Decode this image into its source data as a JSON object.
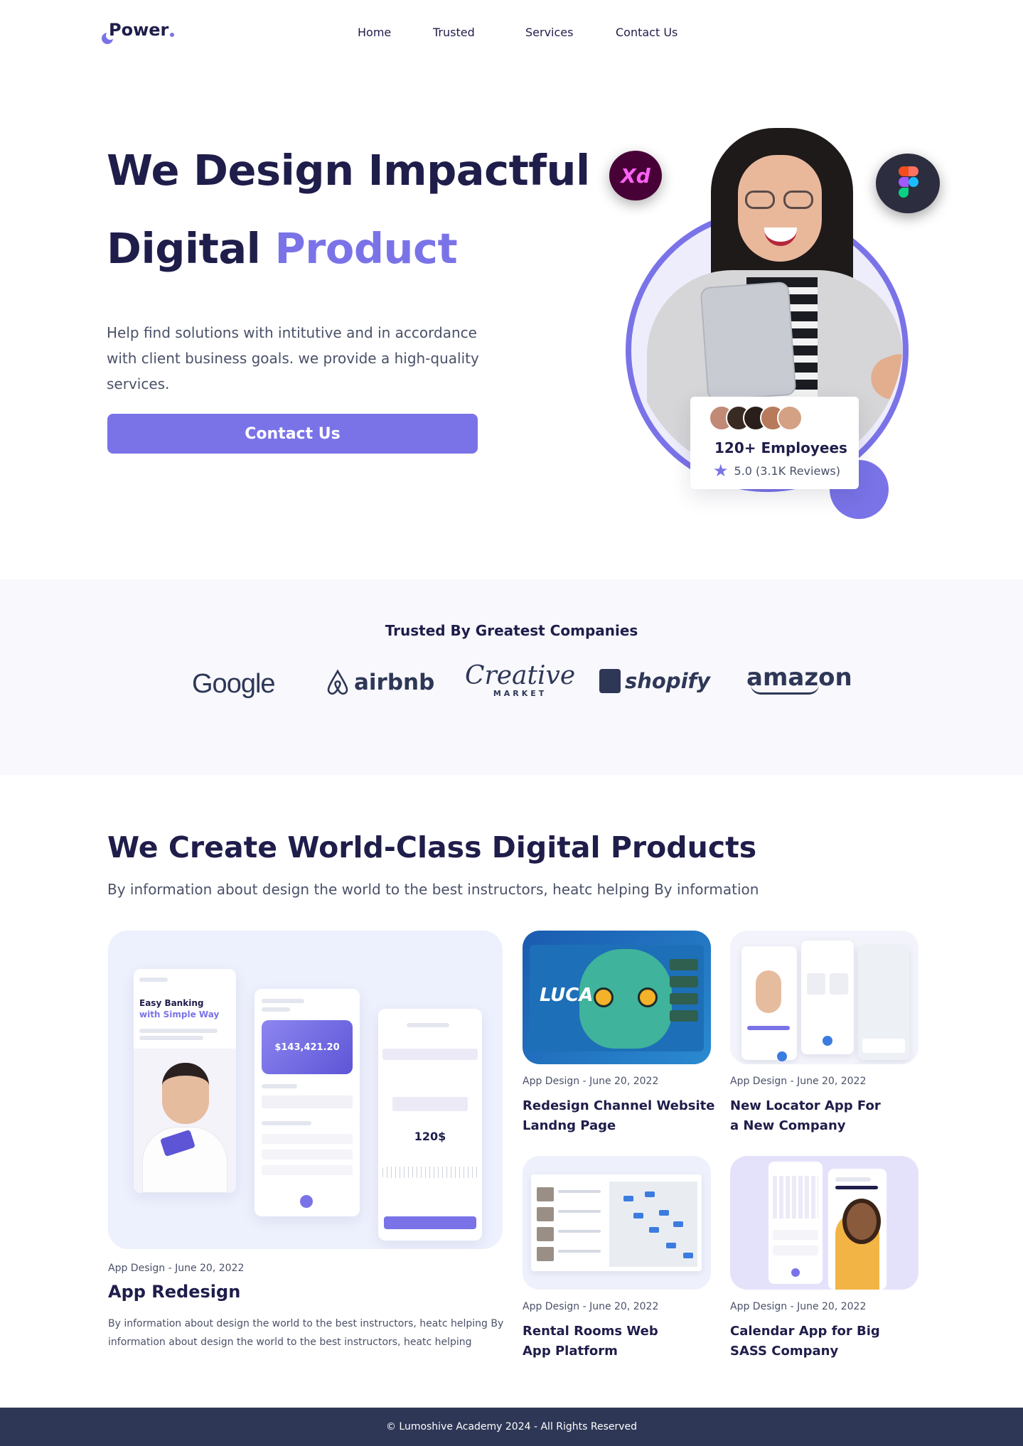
{
  "brand": {
    "name": "Power",
    "accent": "#7a73e8",
    "dark": "#1f1d4a"
  },
  "nav": {
    "items": [
      "Home",
      "Trusted",
      "Services",
      "Contact Us"
    ]
  },
  "hero": {
    "title_line1": "We Design Impactful",
    "title_line2_plain": "Digital",
    "title_line2_accent": "Product",
    "subtitle": "Help find solutions with intitutive and in accordance with client business goals. we provide a high-quality services.",
    "cta": "Contact Us",
    "badges": [
      "adobe-xd-icon",
      "figma-icon"
    ],
    "employees_card": {
      "title": "120+ Employees",
      "rating": "5.0 (3.1K Reviews)",
      "avatars": 5
    }
  },
  "trusted": {
    "title": "Trusted By Greatest Companies",
    "logos": [
      "Google",
      "airbnb",
      "Creative",
      "MARKET",
      "shopify",
      "amazon"
    ]
  },
  "products": {
    "title": "We Create World-Class Digital Products",
    "subtitle": "By information about design the world to the best instructors, heatc helping By information",
    "featured": {
      "meta": "App Design - June 20, 2022",
      "title": "App Redesign",
      "description": "By information about design the world to the best instructors, heatc helping By information about design the world to the best instructors, heatc helping",
      "mockup": {
        "p1_title_a": "Easy Banking",
        "p1_title_b": "with Simple Way",
        "balance": "$143,421.20",
        "amount": "120$"
      }
    },
    "cards": [
      {
        "meta": "App Design - June 20, 2022",
        "title_l1": "Redesign Channel Website",
        "title_l2": "Landng Page",
        "art": "LUCA"
      },
      {
        "meta": "App Design - June 20, 2022",
        "title_l1": "New Locator App For",
        "title_l2": "a New Company"
      },
      {
        "meta": "App Design - June 20, 2022",
        "title_l1": "Rental Rooms Web",
        "title_l2": "App Platform"
      },
      {
        "meta": "App Design - June 20, 2022",
        "title_l1": "Calendar App for Big",
        "title_l2": "SASS Company"
      }
    ]
  },
  "footer": {
    "text": "© Lumoshive Academy 2024 - All Rights Reserved"
  }
}
